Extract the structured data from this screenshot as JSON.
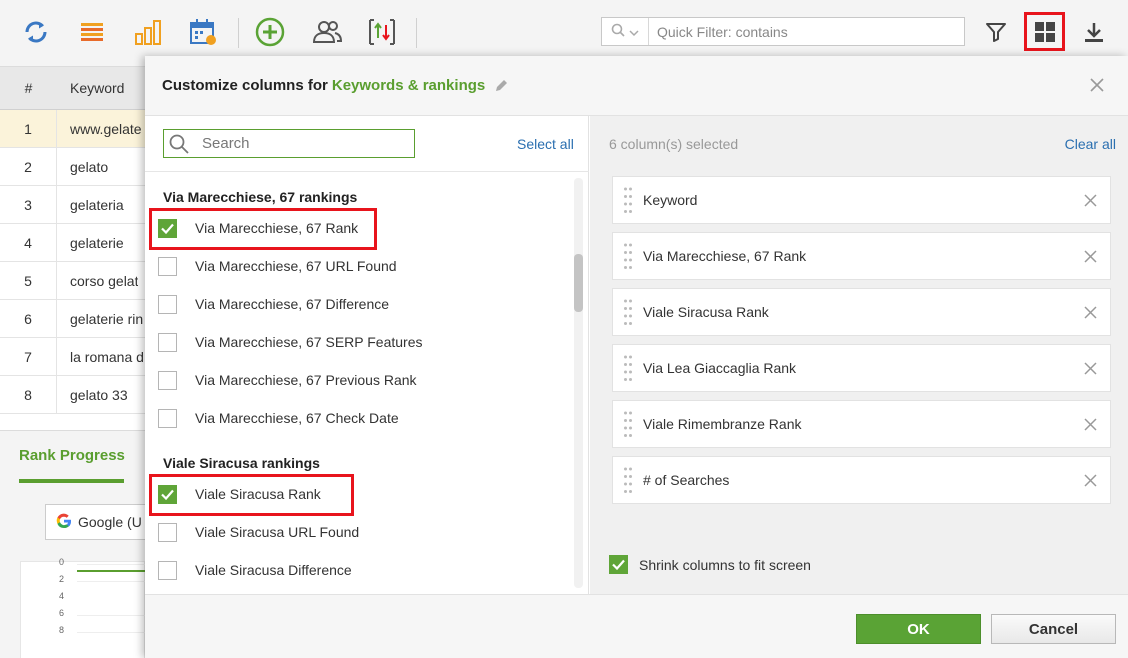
{
  "toolbar": {
    "icons": [
      "refresh-icon",
      "list-icon",
      "bar-chart-icon",
      "calendar-icon",
      "add-icon",
      "users-icon",
      "sort-icon",
      "filter-icon",
      "columns-grid-icon",
      "download-icon"
    ],
    "filter_placeholder": "Quick Filter: contains",
    "colors": {
      "blue": "#3a78c3",
      "orange": "#f0a020",
      "green": "#5aa335",
      "highlight": "#e8141c"
    }
  },
  "background_table": {
    "headers": [
      "#",
      "Keyword"
    ],
    "rows": [
      {
        "num": "1",
        "keyword": "www.gelate"
      },
      {
        "num": "2",
        "keyword": "gelato"
      },
      {
        "num": "3",
        "keyword": "gelateria"
      },
      {
        "num": "4",
        "keyword": "gelaterie"
      },
      {
        "num": "5",
        "keyword": "corso gelat"
      },
      {
        "num": "6",
        "keyword": "gelaterie rin"
      },
      {
        "num": "7",
        "keyword": "la romana d"
      },
      {
        "num": "8",
        "keyword": "gelato 33"
      }
    ]
  },
  "bottom_panel": {
    "tab": "Rank Progress",
    "engine": "Google (U",
    "ticks": [
      "0",
      "2",
      "4",
      "6",
      "8"
    ]
  },
  "modal": {
    "title_prefix": "Customize columns for",
    "title_name": "Keywords & rankings",
    "search_placeholder": "Search",
    "select_all": "Select all",
    "groups": [
      {
        "title": "Via Marecchiese, 67 rankings",
        "options": [
          {
            "label": "Via Marecchiese, 67 Rank",
            "checked": true
          },
          {
            "label": "Via Marecchiese, 67 URL Found",
            "checked": false
          },
          {
            "label": "Via Marecchiese, 67 Difference",
            "checked": false
          },
          {
            "label": "Via Marecchiese, 67 SERP Features",
            "checked": false
          },
          {
            "label": "Via Marecchiese, 67 Previous Rank",
            "checked": false
          },
          {
            "label": "Via Marecchiese, 67 Check Date",
            "checked": false
          }
        ]
      },
      {
        "title": "Viale Siracusa rankings",
        "options": [
          {
            "label": "Viale Siracusa Rank",
            "checked": true
          },
          {
            "label": "Viale Siracusa URL Found",
            "checked": false
          },
          {
            "label": "Viale Siracusa Difference",
            "checked": false
          }
        ]
      }
    ],
    "selected_count": "6 column(s) selected",
    "clear_all": "Clear all",
    "selected": [
      "Keyword",
      "Via Marecchiese, 67 Rank",
      "Viale Siracusa Rank",
      "Via Lea Giaccaglia Rank",
      "Viale Rimembranze Rank",
      "# of Searches"
    ],
    "shrink_label": "Shrink columns to fit screen",
    "ok": "OK",
    "cancel": "Cancel"
  }
}
